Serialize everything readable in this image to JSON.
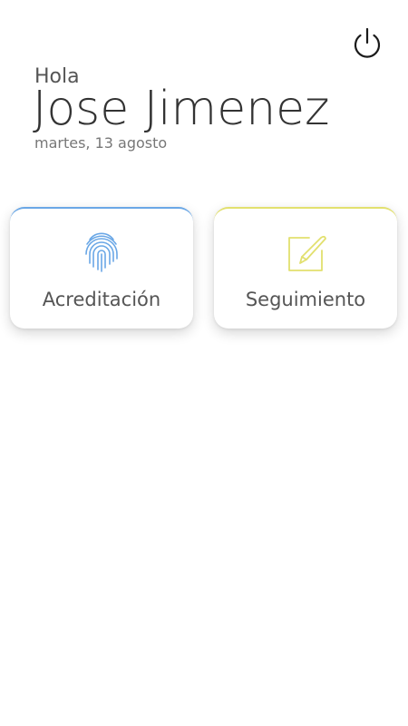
{
  "header": {
    "greeting": "Hola",
    "user_name": "Jose Jimenez",
    "date": "martes, 13 agosto"
  },
  "toolbar": {
    "power_icon": "power-icon"
  },
  "cards": [
    {
      "label": "Acreditación",
      "icon": "fingerprint-icon",
      "accent_color": "#6aa7e6"
    },
    {
      "label": "Seguimiento",
      "icon": "edit-icon",
      "accent_color": "#e2e06e"
    }
  ]
}
